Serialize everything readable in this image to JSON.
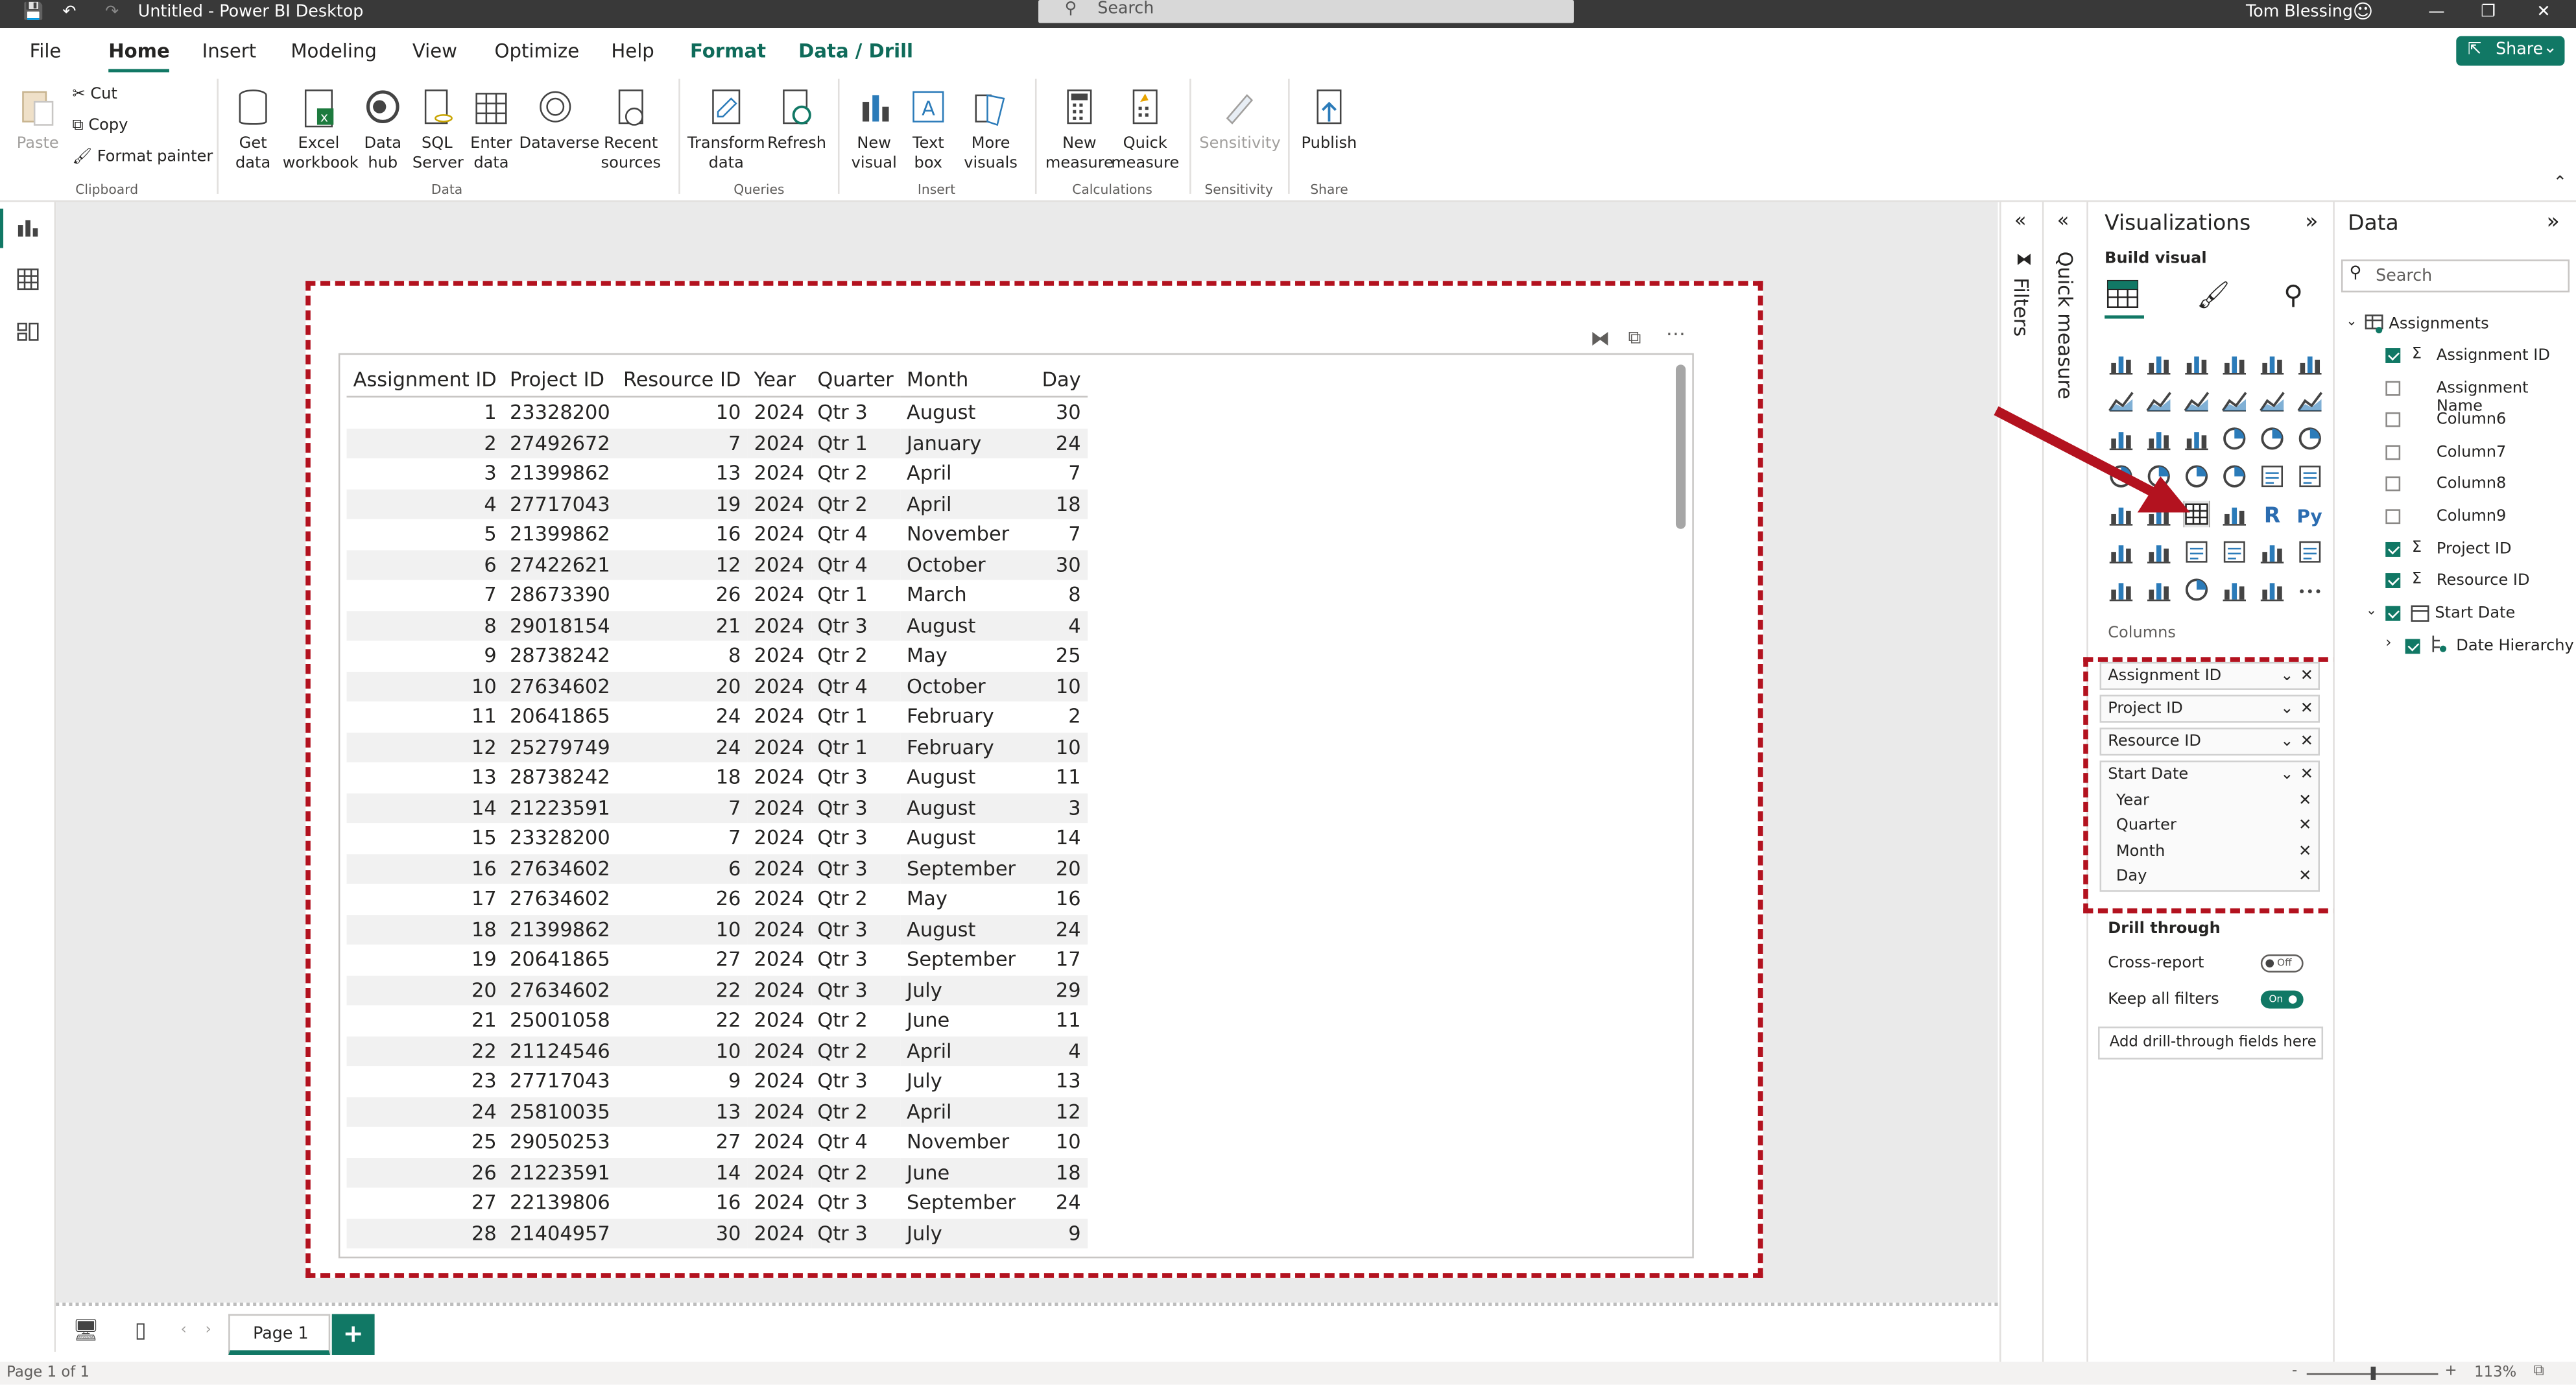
{
  "window": {
    "title": "Untitled - Power BI Desktop",
    "search_placeholder": "Search",
    "user": "Tom Blessing"
  },
  "menu": {
    "tabs": [
      "File",
      "Home",
      "Insert",
      "Modeling",
      "View",
      "Optimize",
      "Help",
      "Format",
      "Data / Drill"
    ],
    "active": "Home",
    "share_label": "Share"
  },
  "ribbon": {
    "clipboard": {
      "paste": "Paste",
      "cut": "Cut",
      "copy": "Copy",
      "format_painter": "Format painter",
      "group": "Clipboard"
    },
    "data": {
      "get_data": "Get\ndata",
      "excel": "Excel\nworkbook",
      "data_hub": "Data\nhub",
      "sql": "SQL\nServer",
      "enter": "Enter\ndata",
      "dataverse": "Dataverse",
      "recent": "Recent\nsources",
      "group": "Data"
    },
    "queries": {
      "transform": "Transform\ndata",
      "refresh": "Refresh",
      "group": "Queries"
    },
    "insert": {
      "new_visual": "New\nvisual",
      "text_box": "Text\nbox",
      "more_visuals": "More\nvisuals",
      "group": "Insert"
    },
    "calculations": {
      "new_measure": "New\nmeasure",
      "quick_measure": "Quick\nmeasure",
      "group": "Calculations"
    },
    "sensitivity": {
      "label": "Sensitivity",
      "group": "Sensitivity"
    },
    "share": {
      "publish": "Publish",
      "group": "Share"
    }
  },
  "table": {
    "columns": [
      "Assignment ID",
      "Project ID",
      "Resource ID",
      "Year",
      "Quarter",
      "Month",
      "Day"
    ],
    "rows": [
      [
        1,
        23328200,
        10,
        2024,
        "Qtr 3",
        "August",
        30
      ],
      [
        2,
        27492672,
        7,
        2024,
        "Qtr 1",
        "January",
        24
      ],
      [
        3,
        21399862,
        13,
        2024,
        "Qtr 2",
        "April",
        7
      ],
      [
        4,
        27717043,
        19,
        2024,
        "Qtr 2",
        "April",
        18
      ],
      [
        5,
        21399862,
        16,
        2024,
        "Qtr 4",
        "November",
        7
      ],
      [
        6,
        27422621,
        12,
        2024,
        "Qtr 4",
        "October",
        30
      ],
      [
        7,
        28673390,
        26,
        2024,
        "Qtr 1",
        "March",
        8
      ],
      [
        8,
        29018154,
        21,
        2024,
        "Qtr 3",
        "August",
        4
      ],
      [
        9,
        28738242,
        8,
        2024,
        "Qtr 2",
        "May",
        25
      ],
      [
        10,
        27634602,
        20,
        2024,
        "Qtr 4",
        "October",
        10
      ],
      [
        11,
        20641865,
        24,
        2024,
        "Qtr 1",
        "February",
        2
      ],
      [
        12,
        25279749,
        24,
        2024,
        "Qtr 1",
        "February",
        10
      ],
      [
        13,
        28738242,
        18,
        2024,
        "Qtr 3",
        "August",
        11
      ],
      [
        14,
        21223591,
        7,
        2024,
        "Qtr 3",
        "August",
        3
      ],
      [
        15,
        23328200,
        7,
        2024,
        "Qtr 3",
        "August",
        14
      ],
      [
        16,
        27634602,
        6,
        2024,
        "Qtr 3",
        "September",
        20
      ],
      [
        17,
        27634602,
        26,
        2024,
        "Qtr 2",
        "May",
        16
      ],
      [
        18,
        21399862,
        10,
        2024,
        "Qtr 3",
        "August",
        24
      ],
      [
        19,
        20641865,
        27,
        2024,
        "Qtr 3",
        "September",
        17
      ],
      [
        20,
        27634602,
        22,
        2024,
        "Qtr 3",
        "July",
        29
      ],
      [
        21,
        25001058,
        22,
        2024,
        "Qtr 2",
        "June",
        11
      ],
      [
        22,
        21124546,
        10,
        2024,
        "Qtr 2",
        "April",
        4
      ],
      [
        23,
        27717043,
        9,
        2024,
        "Qtr 3",
        "July",
        13
      ],
      [
        24,
        25810035,
        13,
        2024,
        "Qtr 2",
        "April",
        12
      ],
      [
        25,
        29050253,
        27,
        2024,
        "Qtr 4",
        "November",
        10
      ],
      [
        26,
        21223591,
        14,
        2024,
        "Qtr 2",
        "June",
        18
      ],
      [
        27,
        22139806,
        16,
        2024,
        "Qtr 3",
        "September",
        24
      ],
      [
        28,
        21404957,
        30,
        2024,
        "Qtr 3",
        "July",
        9
      ]
    ]
  },
  "pages": {
    "tab": "Page 1",
    "status": "Page 1 of 1",
    "zoom": "113%"
  },
  "panes": {
    "filters": "Filters",
    "quick_measure": "Quick measure",
    "visualizations": "Visualizations",
    "build_visual": "Build visual",
    "columns_label": "Columns",
    "column_wells": [
      "Assignment ID",
      "Project ID",
      "Resource ID",
      "Start Date"
    ],
    "date_sub_wells": [
      "Year",
      "Quarter",
      "Month",
      "Day"
    ],
    "drill_through": "Drill through",
    "cross_report": "Cross-report",
    "cross_report_state": "Off",
    "keep_filters": "Keep all filters",
    "keep_filters_state": "On",
    "add_drill": "Add drill-through fields here"
  },
  "data_pane": {
    "title": "Data",
    "search_placeholder": "Search",
    "table": "Assignments",
    "fields": [
      {
        "name": "Assignment ID",
        "checked": true,
        "sigma": true
      },
      {
        "name": "Assignment Name",
        "checked": false,
        "sigma": false
      },
      {
        "name": "Column6",
        "checked": false,
        "sigma": false
      },
      {
        "name": "Column7",
        "checked": false,
        "sigma": false
      },
      {
        "name": "Column8",
        "checked": false,
        "sigma": false
      },
      {
        "name": "Column9",
        "checked": false,
        "sigma": false
      },
      {
        "name": "Project ID",
        "checked": true,
        "sigma": true
      },
      {
        "name": "Resource ID",
        "checked": true,
        "sigma": true
      }
    ],
    "start_date": "Start Date",
    "date_hierarchy": "Date Hierarchy"
  },
  "colors": {
    "accent": "#117865",
    "highlight": "#b3121f",
    "titlebar": "#393939"
  }
}
